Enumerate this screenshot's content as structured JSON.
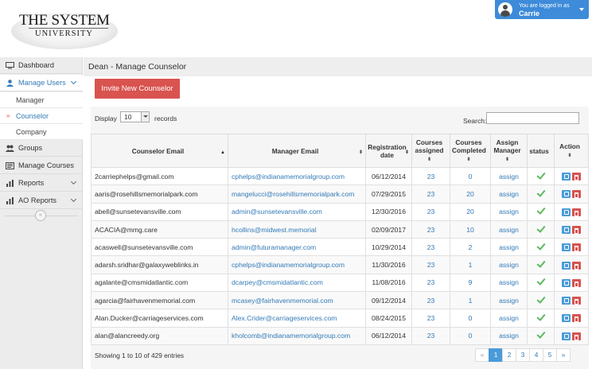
{
  "logo": {
    "line1": "THE SYSTEM",
    "line2": "UNIVERSITY"
  },
  "user": {
    "logged_in_label": "You are logged in as",
    "name": "Carrie"
  },
  "sidebar": {
    "items": [
      {
        "label": "Dashboard",
        "icon": "monitor-icon"
      },
      {
        "label": "Manage Users",
        "icon": "user-icon"
      },
      {
        "label": "Groups",
        "icon": "users-icon"
      },
      {
        "label": "Manage Courses",
        "icon": "book-icon"
      },
      {
        "label": "Reports",
        "icon": "chart-icon"
      },
      {
        "label": "AO Reports",
        "icon": "chart-icon"
      }
    ],
    "sub_items": [
      {
        "label": "Manager"
      },
      {
        "label": "Counselor"
      },
      {
        "label": "Company"
      }
    ],
    "collapse_glyph": "«"
  },
  "page": {
    "title": "Dean - Manage Counselor",
    "invite_label": "Invite New Counselor"
  },
  "table_controls": {
    "display_label": "Display",
    "display_value": "10",
    "records_label": "records",
    "search_label": "Search:"
  },
  "table": {
    "headers": {
      "counselor_email": "Counselor Email",
      "manager_email": "Manager Email",
      "reg_date_1": "Registration",
      "reg_date_2": "date",
      "courses_assigned_1": "Courses",
      "courses_assigned_2": "assigned",
      "courses_completed_1": "Courses",
      "courses_completed_2": "Completed",
      "assign_manager_1": "Assign",
      "assign_manager_2": "Manager",
      "status": "status",
      "action": "Action"
    },
    "rows": [
      {
        "email": "2carriephelps@gmail.com",
        "manager": "cphelps@indianamemorialgroup.com",
        "date": "06/12/2014",
        "assigned": "23",
        "completed": "0",
        "assign": "assign"
      },
      {
        "email": "aaris@rosehillsmemorialpark.com",
        "manager": "mangelucci@rosehillsmemorialpark.com",
        "date": "07/29/2015",
        "assigned": "23",
        "completed": "20",
        "assign": "assign"
      },
      {
        "email": "abell@sunsetevansville.com",
        "manager": "admin@sunsetevansville.com",
        "date": "12/30/2016",
        "assigned": "23",
        "completed": "20",
        "assign": "assign"
      },
      {
        "email": "ACACIA@mmg.care",
        "manager": "hcollins@midwest.memorial",
        "date": "02/09/2017",
        "assigned": "23",
        "completed": "10",
        "assign": "assign"
      },
      {
        "email": "acaswell@sunsetevansville.com",
        "manager": "admin@futuramanager.com",
        "date": "10/29/2014",
        "assigned": "23",
        "completed": "2",
        "assign": "assign"
      },
      {
        "email": "adarsh.sridhar@galaxyweblinks.in",
        "manager": "cphelps@indianamemorialgroup.com",
        "date": "11/30/2016",
        "assigned": "23",
        "completed": "1",
        "assign": "assign"
      },
      {
        "email": "agalante@cmsmidatlantic.com",
        "manager": "dcarpey@cmsmidatlantic.com",
        "date": "11/08/2016",
        "assigned": "23",
        "completed": "9",
        "assign": "assign"
      },
      {
        "email": "agarcia@fairhavenmemorial.com",
        "manager": "mcasey@fairhavenmemorial.com",
        "date": "09/12/2014",
        "assigned": "23",
        "completed": "1",
        "assign": "assign"
      },
      {
        "email": "Alan.Ducker@carriageservices.com",
        "manager": "Alex.Crider@carriageservices.com",
        "date": "08/24/2015",
        "assigned": "23",
        "completed": "0",
        "assign": "assign"
      },
      {
        "email": "alan@alancreedy.org",
        "manager": "kholcomb@indianamemorialgroup.com",
        "date": "06/12/2014",
        "assigned": "23",
        "completed": "0",
        "assign": "assign"
      }
    ]
  },
  "footer": {
    "showing": "Showing 1 to 10 of 429 entries",
    "pages": [
      "1",
      "2",
      "3",
      "4",
      "5"
    ],
    "prev": "«",
    "next": "»"
  },
  "colors": {
    "accent": "#337ab7",
    "danger": "#d9534f",
    "success": "#5cb85c",
    "user_box": "#3d8bd9"
  }
}
